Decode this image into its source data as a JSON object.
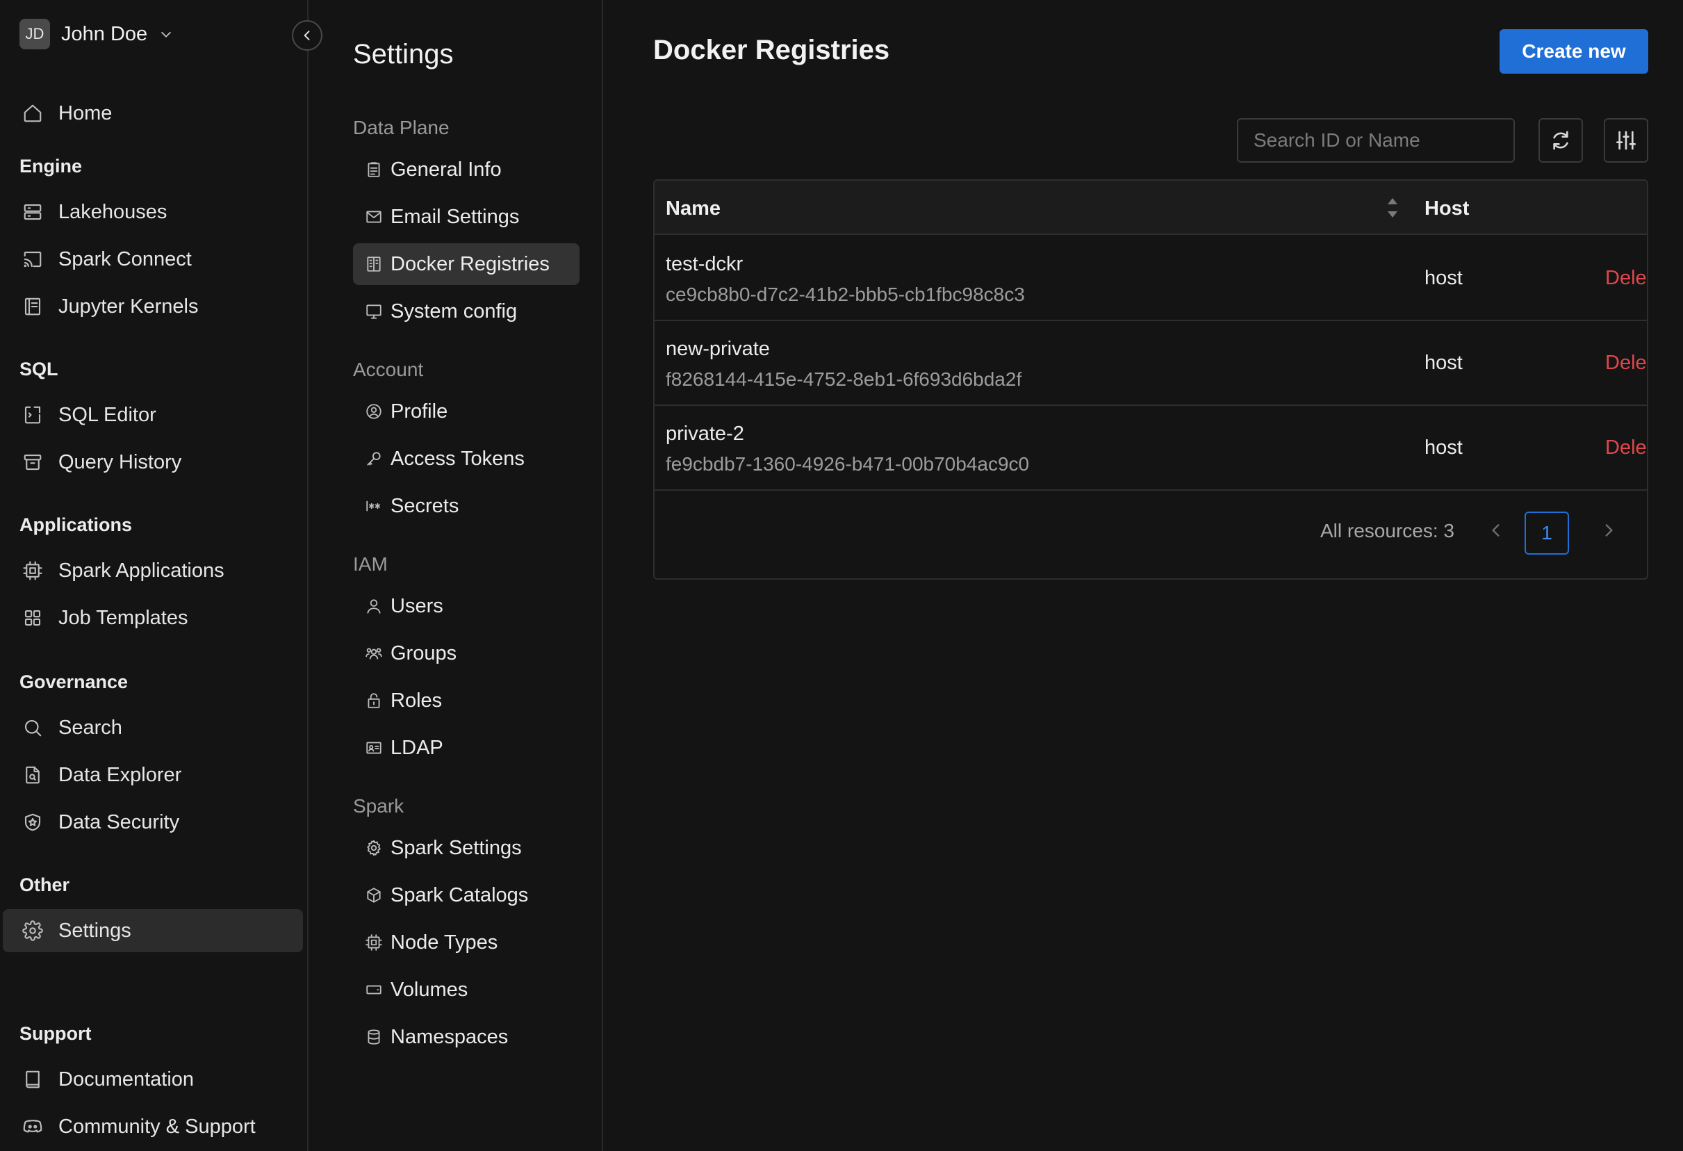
{
  "user": {
    "initials": "JD",
    "name": "John Doe"
  },
  "sidebar": {
    "home": "Home",
    "groups": {
      "engine": "Engine",
      "sql": "SQL",
      "applications": "Applications",
      "governance": "Governance",
      "other": "Other",
      "support": "Support"
    },
    "items": {
      "lakehouses": "Lakehouses",
      "spark_connect": "Spark Connect",
      "jupyter_kernels": "Jupyter Kernels",
      "sql_editor": "SQL Editor",
      "query_history": "Query History",
      "spark_applications": "Spark Applications",
      "job_templates": "Job Templates",
      "search": "Search",
      "data_explorer": "Data Explorer",
      "data_security": "Data Security",
      "settings": "Settings",
      "documentation": "Documentation",
      "community": "Community & Support"
    }
  },
  "settings_nav": {
    "title": "Settings",
    "groups": {
      "data_plane": "Data Plane",
      "account": "Account",
      "iam": "IAM",
      "spark": "Spark"
    },
    "items": {
      "general_info": "General Info",
      "email_settings": "Email Settings",
      "docker_registries": "Docker Registries",
      "system_config": "System config",
      "profile": "Profile",
      "access_tokens": "Access Tokens",
      "secrets": "Secrets",
      "users": "Users",
      "groups": "Groups",
      "roles": "Roles",
      "ldap": "LDAP",
      "spark_settings": "Spark Settings",
      "spark_catalogs": "Spark Catalogs",
      "node_types": "Node Types",
      "volumes": "Volumes",
      "namespaces": "Namespaces"
    }
  },
  "main": {
    "title": "Docker Registries",
    "create_label": "Create new",
    "search_placeholder": "Search ID or Name",
    "table": {
      "col_name": "Name",
      "col_host": "Host",
      "rows": [
        {
          "name": "test-dckr",
          "id": "ce9cb8b0-d7c2-41b2-bbb5-cb1fbc98c8c3",
          "host": "host",
          "action": "Delete"
        },
        {
          "name": "new-private",
          "id": "f8268144-415e-4752-8eb1-6f693d6bda2f",
          "host": "host",
          "action": "Delete"
        },
        {
          "name": "private-2",
          "id": "fe9cbdb7-1360-4926-b471-00b70b4ac9c0",
          "host": "host",
          "action": "Delete"
        }
      ]
    },
    "pagination": {
      "total_label": "All resources: 3",
      "current_page": "1"
    }
  },
  "colors": {
    "accent": "#1f6fd6",
    "danger": "#e0474c",
    "background": "#141414"
  }
}
